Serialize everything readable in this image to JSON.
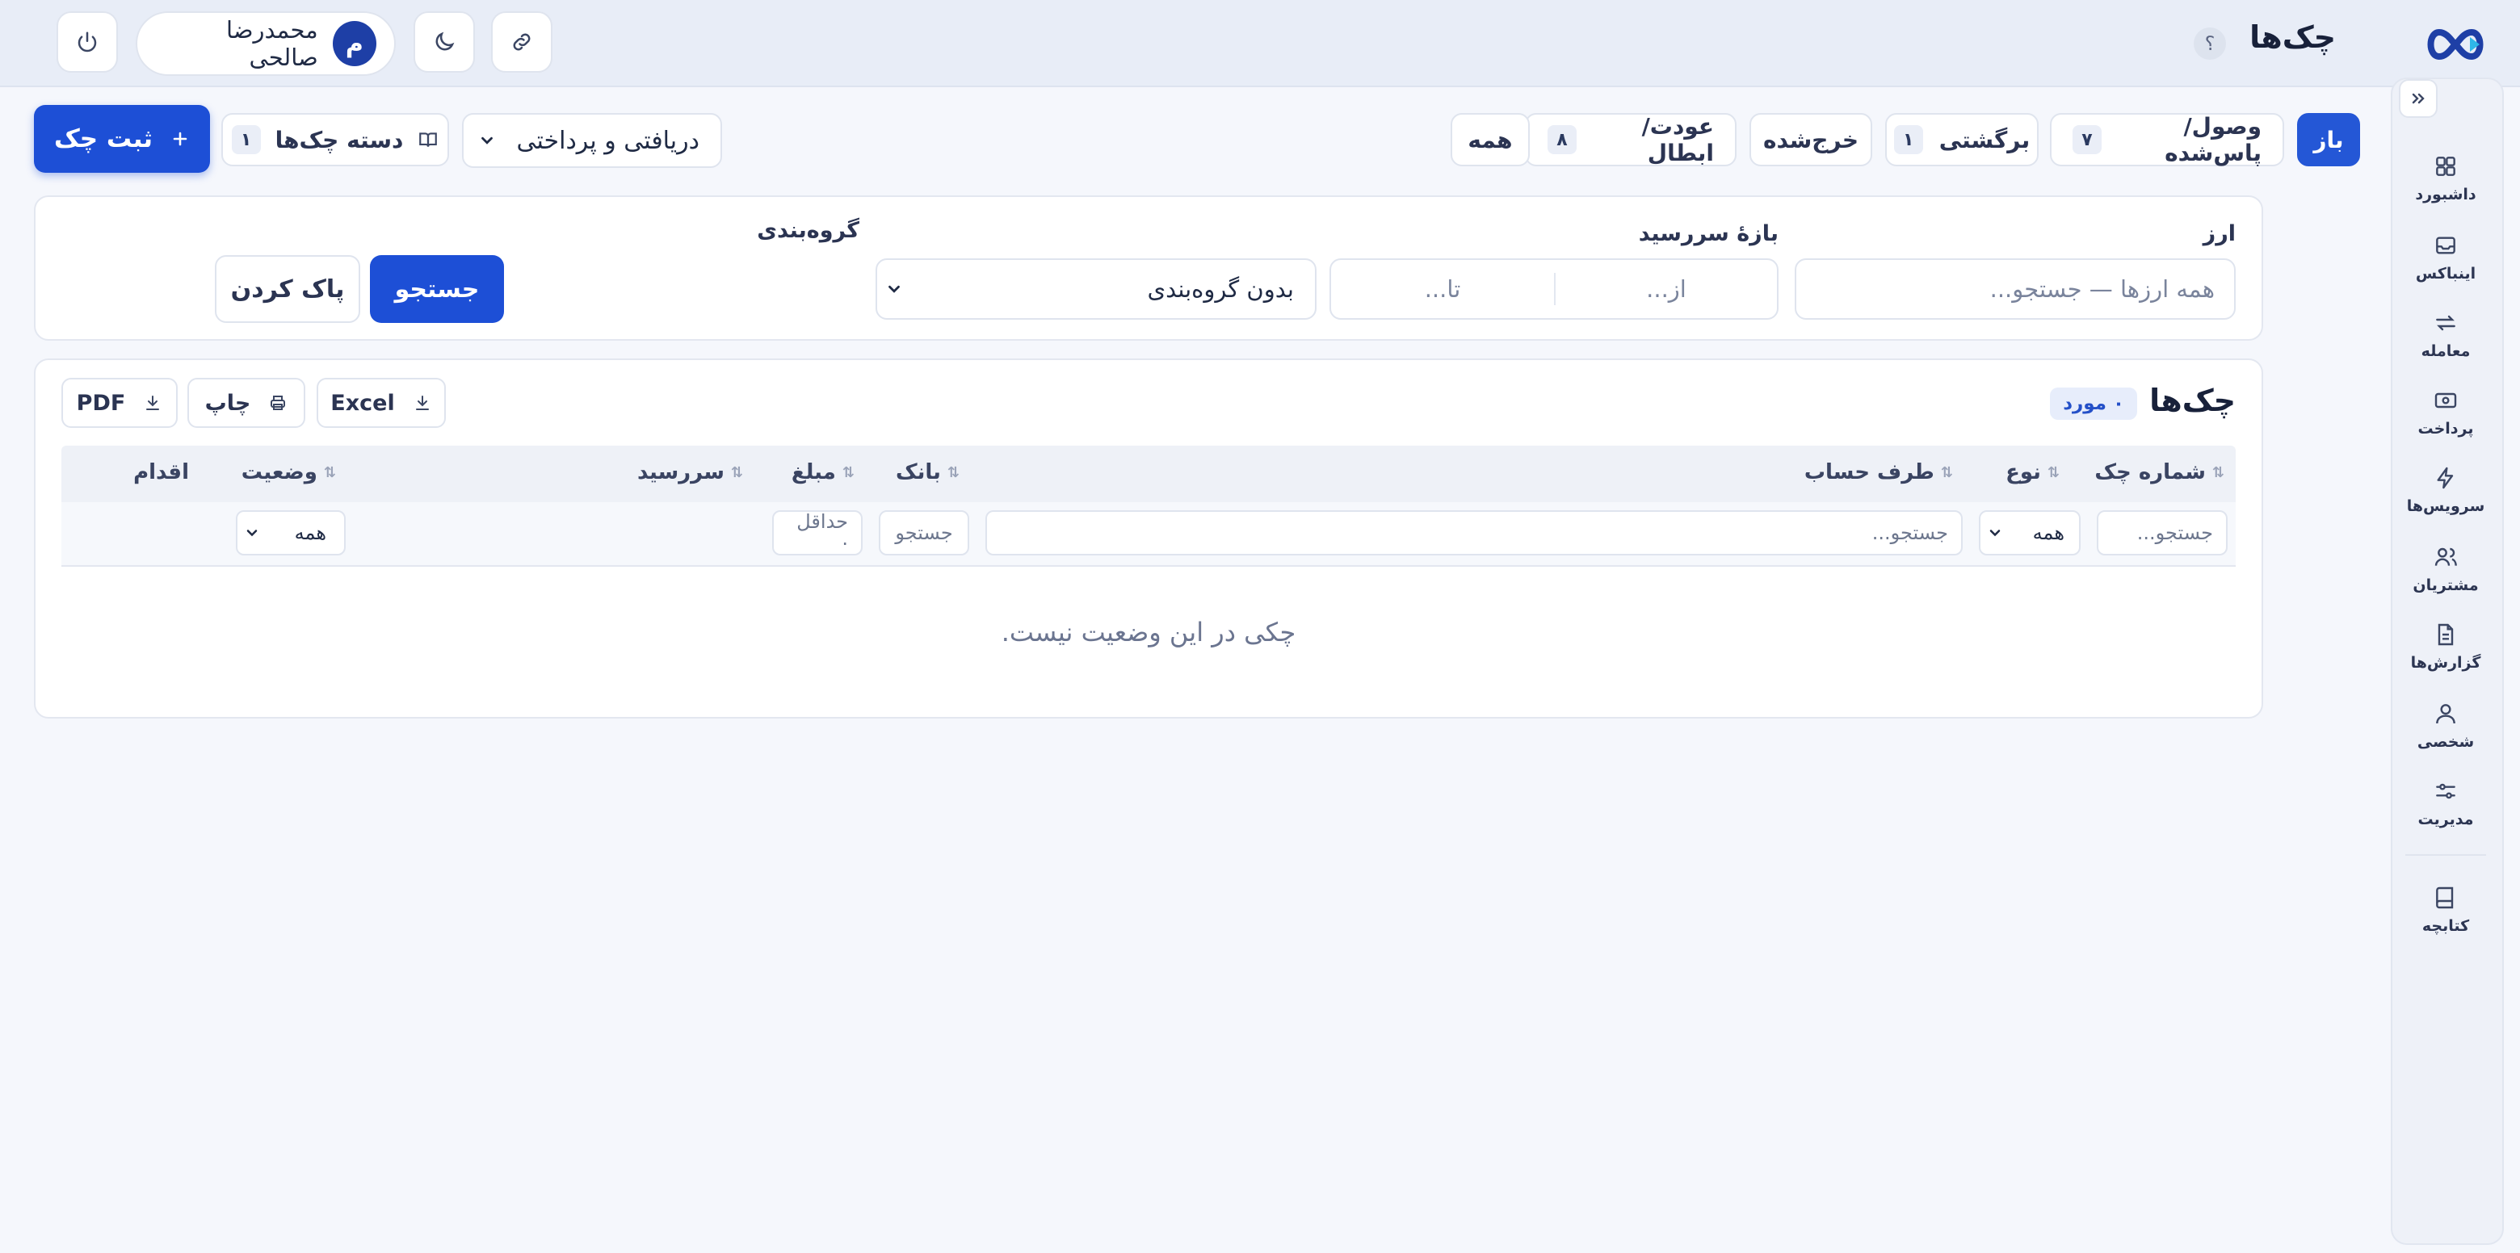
{
  "header": {
    "title": "چک‌ها",
    "help": "؟",
    "user_name": "محمدرضا صالحی",
    "avatar_initial": "م"
  },
  "sidebar": {
    "items": [
      {
        "label": "داشبورد",
        "icon": "grid-icon"
      },
      {
        "label": "اینباکس",
        "icon": "inbox-icon"
      },
      {
        "label": "معامله",
        "icon": "swap-icon"
      },
      {
        "label": "پرداخت",
        "icon": "cash-icon"
      },
      {
        "label": "سرویس‌ها",
        "icon": "bolt-icon"
      },
      {
        "label": "مشتریان",
        "icon": "users-icon"
      },
      {
        "label": "گزارش‌ها",
        "icon": "report-icon"
      },
      {
        "label": "شخصی",
        "icon": "user-icon"
      },
      {
        "label": "مدیریت",
        "icon": "sliders-icon"
      },
      {
        "label": "کتابچه",
        "icon": "book-icon"
      }
    ]
  },
  "tabs": [
    {
      "label": "باز",
      "count": null,
      "active": true
    },
    {
      "label": "وصول/پاس‌شده",
      "count": "۷"
    },
    {
      "label": "برگشتی",
      "count": "۱"
    },
    {
      "label": "خرج‌شده",
      "count": null
    },
    {
      "label": "عودت/ابطال",
      "count": "۸"
    },
    {
      "label": "همه",
      "count": null
    }
  ],
  "type_select": {
    "value": "دریافتی و پرداختی"
  },
  "batch_button": {
    "label": "دسته چک‌ها",
    "count": "۱"
  },
  "new_check_button": {
    "label": "ثبت چک"
  },
  "filters": {
    "currency_label": "ارز",
    "currency_placeholder": "همه ارزها — جستجو...",
    "due_label": "بازهٔ سررسید",
    "from_placeholder": "از...",
    "to_placeholder": "تا...",
    "group_label": "گروه‌بندی",
    "group_value": "بدون گروه‌بندی",
    "search_button": "جستجو",
    "clear_button": "پاک کردن"
  },
  "table": {
    "title": "چک‌ها",
    "count_badge": "۰ مورد",
    "export": {
      "excel": "Excel",
      "print": "چاپ",
      "pdf": "PDF"
    },
    "columns": [
      "شماره چک",
      "نوع",
      "طرف حساب",
      "بانک",
      "مبلغ",
      "سررسید",
      "وضعیت",
      "اقدام"
    ],
    "row_filters": {
      "number_placeholder": "جستجو...",
      "type_value": "همه",
      "party_placeholder": "جستجو...",
      "bank_placeholder": "جستجو",
      "amount_placeholder": "حداقل ·",
      "status_value": "همه"
    },
    "empty_message": "چکی در این وضعیت نیست."
  },
  "colors": {
    "primary": "#1d4fd6",
    "brand": "#1e3fa6",
    "background": "#f5f7fc"
  }
}
